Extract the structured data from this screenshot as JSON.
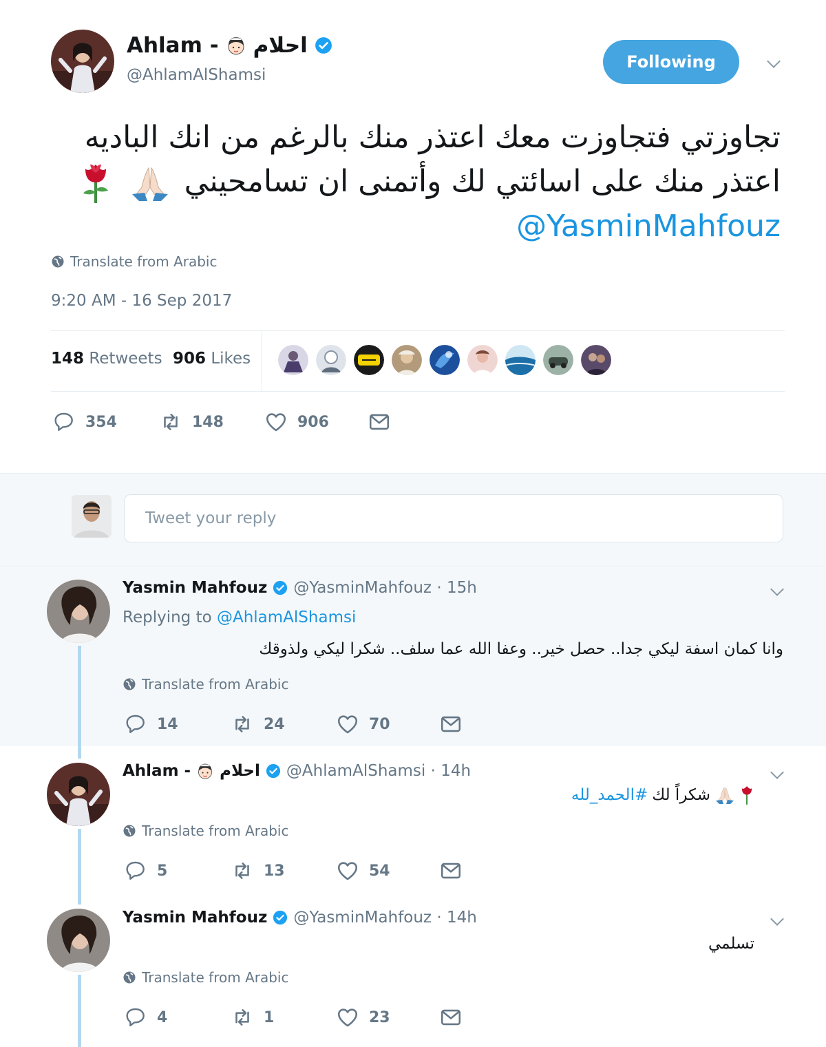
{
  "colors": {
    "accent": "#1b95e0",
    "follow_bg": "#45a5e0",
    "verified": "#1da1f2",
    "muted": "#657786",
    "thread_line": "#b3d7f0",
    "reply_bg": "#f5f8fa"
  },
  "main_tweet": {
    "author_name": "Ahlam -",
    "author_name_ar": "احلام",
    "author_handle": "@AhlamAlShamsi",
    "follow_label": "Following",
    "text_ar": "تجاوزتي فتجاوزت معك اعتذر منك بالرغم من انك الباديه اعتذر منك على اسائتي لك وأتمنى ان تسامحيني",
    "mention": "@YasminMahfouz",
    "translate_label": "Translate from Arabic",
    "timestamp": "9:20 AM - 16 Sep 2017",
    "retweets_count": "148",
    "retweets_label": "Retweets",
    "likes_count": "906",
    "likes_label": "Likes",
    "actions": {
      "replies": "354",
      "retweets": "148",
      "likes": "906"
    }
  },
  "reply_box": {
    "placeholder": "Tweet your reply"
  },
  "replies": [
    {
      "name": "Yasmin Mahfouz",
      "handle_time": "@YasminMahfouz · 15h",
      "replying_label": "Replying to",
      "replying_to": "@AhlamAlShamsi",
      "text": "وانا كمان اسفة ليكي جدا.. حصل خير..  وعفا الله عما سلف.. شكرا ليكي ولذوقك",
      "translate_label": "Translate from Arabic",
      "actions": {
        "replies": "14",
        "retweets": "24",
        "likes": "70"
      }
    },
    {
      "name": "Ahlam -",
      "name_ar": "احلام",
      "handle_time": "@AhlamAlShamsi · 14h",
      "text": "شكراً لك",
      "hashtag": "#الحمد_لله",
      "translate_label": "Translate from Arabic",
      "actions": {
        "replies": "5",
        "retweets": "13",
        "likes": "54"
      }
    },
    {
      "name": "Yasmin Mahfouz",
      "handle_time": "@YasminMahfouz · 14h",
      "text": "تسلمي",
      "translate_label": "Translate from Arabic",
      "actions": {
        "replies": "4",
        "retweets": "1",
        "likes": "23"
      }
    }
  ]
}
